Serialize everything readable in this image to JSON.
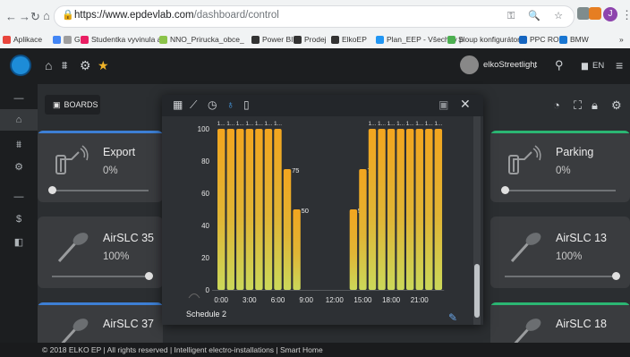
{
  "browser": {
    "url_host": "https://www.epdevlab.com",
    "url_path": "/dashboard/control",
    "profile_initial": "J",
    "bookmarks": [
      {
        "label": "Aplikace",
        "color": "#e8453c"
      },
      {
        "label": "G",
        "color": "#4285f4"
      },
      {
        "label": "G",
        "color": "#9e9e9e"
      },
      {
        "label": "Studentka vyvinula a",
        "color": "#e91e63"
      },
      {
        "label": "NNO_Prirucka_obce_",
        "color": "#8bc34a"
      },
      {
        "label": "Power BI",
        "color": "#333333"
      },
      {
        "label": "Prodej",
        "color": "#333333"
      },
      {
        "label": "ElkoEP",
        "color": "#333333"
      },
      {
        "label": "Plan_EEP - Všechny p",
        "color": "#2196f3"
      },
      {
        "label": "Sloup konfigurátor",
        "color": "#4caf50"
      },
      {
        "label": "PPC ROI",
        "color": "#1565c0"
      },
      {
        "label": "BMW",
        "color": "#1976d2"
      }
    ],
    "more": "»"
  },
  "app": {
    "username": "elkoStreetlight",
    "language": "EN",
    "boards_label": "BOARDS",
    "footer": "© 2018 ELKO EP | All rights reserved | Intelligent electro-installations | Smart Home"
  },
  "cards": [
    {
      "title": "Export",
      "value": "0%",
      "accent": "blue",
      "icon": "wall-light-icon"
    },
    {
      "title": "Parking",
      "value": "0%",
      "accent": "green",
      "icon": "wall-light-icon"
    },
    {
      "title": "AirSLC 35",
      "value": "100%",
      "accent": "none",
      "icon": "street-lamp-icon"
    },
    {
      "title": "AirSLC 13",
      "value": "100%",
      "accent": "none",
      "icon": "street-lamp-icon"
    },
    {
      "title": "AirSLC 37",
      "value": "",
      "accent": "blue",
      "icon": "street-lamp-icon"
    },
    {
      "title": "AirSLC 18",
      "value": "",
      "accent": "green",
      "icon": "street-lamp-icon"
    }
  ],
  "modal": {
    "schedule_name": "Schedule 2",
    "tools": [
      "grid-icon",
      "trend-icon",
      "history-icon",
      "bulb-icon",
      "doc-icon"
    ]
  },
  "chart_data": {
    "type": "bar",
    "x": [
      0,
      1,
      2,
      3,
      4,
      5,
      6,
      7,
      8,
      9,
      10,
      11,
      12,
      13,
      14,
      15,
      16,
      17,
      18,
      19,
      20,
      21,
      22,
      23
    ],
    "x_tick_labels": [
      "0:00",
      "3:00",
      "6:00",
      "9:00",
      "12:00",
      "15:00",
      "18:00",
      "21:00"
    ],
    "x_ticks": [
      0,
      3,
      6,
      9,
      12,
      15,
      18,
      21
    ],
    "y_ticks": [
      0,
      20,
      40,
      60,
      80,
      100
    ],
    "ylim": [
      0,
      100
    ],
    "values": [
      100,
      100,
      100,
      100,
      100,
      100,
      100,
      75,
      50,
      null,
      null,
      null,
      null,
      null,
      50,
      75,
      100,
      100,
      100,
      100,
      100,
      100,
      100,
      100
    ],
    "data_labels": {
      "7": "75",
      "8": "50",
      "14": "50",
      "15": "75"
    },
    "grid": false
  }
}
